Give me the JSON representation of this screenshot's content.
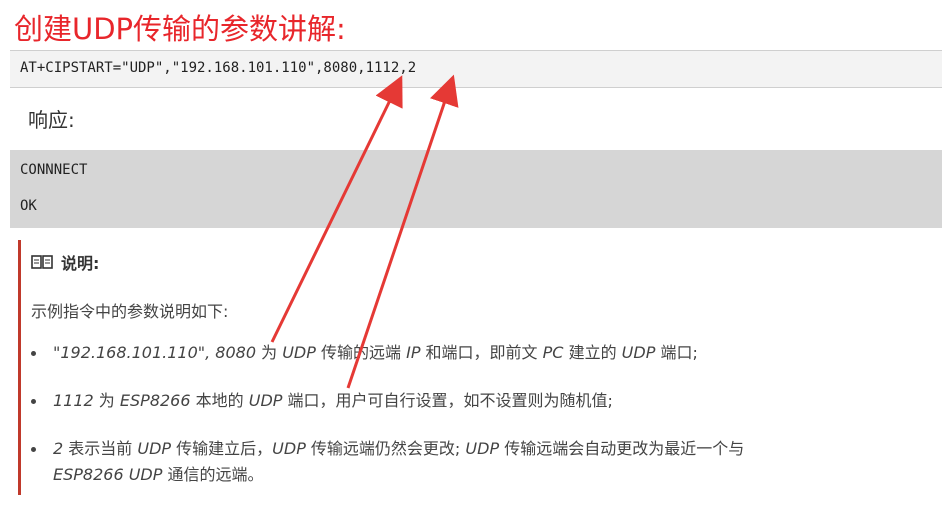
{
  "title": "创建UDP传输的参数讲解:",
  "command": "AT+CIPSTART=\"UDP\",\"192.168.101.110\",8080,1112,2",
  "response_label": "响应:",
  "response_lines": [
    "CONNNECT",
    "OK"
  ],
  "note": {
    "heading": "说明:",
    "intro": "示例指令中的参数说明如下:",
    "bullets": [
      [
        [
          "i",
          "\"192.168.101.110\", 8080"
        ],
        [
          "t",
          " 为 "
        ],
        [
          "i",
          "UDP"
        ],
        [
          "t",
          " 传输的远端 "
        ],
        [
          "i",
          "IP"
        ],
        [
          "t",
          " 和端口，即前文 "
        ],
        [
          "i",
          "PC"
        ],
        [
          "t",
          " 建立的 "
        ],
        [
          "i",
          "UDP"
        ],
        [
          "t",
          " 端口;"
        ]
      ],
      [
        [
          "i",
          "1112"
        ],
        [
          "t",
          " 为 "
        ],
        [
          "i",
          "ESP8266"
        ],
        [
          "t",
          " 本地的 "
        ],
        [
          "i",
          "UDP"
        ],
        [
          "t",
          " 端口，用户可自行设置，如不设置则为随机值;"
        ]
      ],
      [
        [
          "i",
          "2"
        ],
        [
          "t",
          " 表示当前 "
        ],
        [
          "i",
          "UDP"
        ],
        [
          "t",
          " 传输建立后，"
        ],
        [
          "i",
          "UDP"
        ],
        [
          "t",
          " 传输远端仍然会更改; "
        ],
        [
          "i",
          "UDP"
        ],
        [
          "t",
          " 传输远端会自动更改为最近一个与"
        ],
        [
          "br",
          ""
        ],
        [
          "i",
          "ESP8266 UDP"
        ],
        [
          "t",
          " 通信的远端。"
        ]
      ]
    ]
  },
  "colors": {
    "title": "#e8262b",
    "arrow": "#e53935",
    "note_border": "#c0392b",
    "response_bg": "#d6d6d6"
  },
  "icons": {
    "note": "book-icon"
  }
}
